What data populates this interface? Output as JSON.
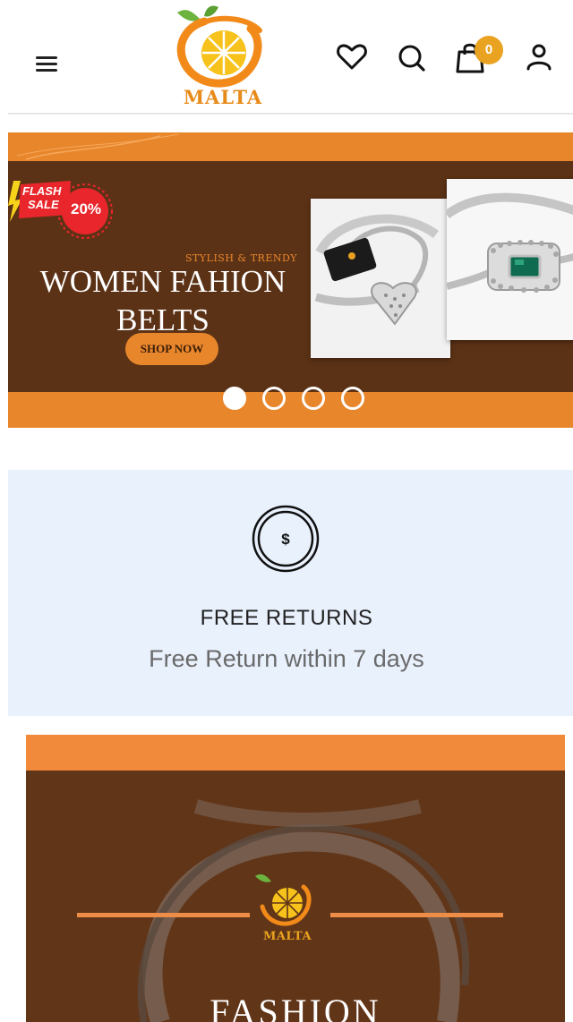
{
  "header": {
    "logo_text": "MALTA",
    "cart_count": "0",
    "icons": {
      "menu": "hamburger-menu-icon",
      "wishlist": "heart-icon",
      "search": "search-icon",
      "cart": "shopping-bag-icon",
      "account": "user-icon"
    }
  },
  "hero": {
    "flash_sale_line1": "FLASH",
    "flash_sale_line2": "SALE",
    "discount": "20%",
    "tagline": "STYLISH & TRENDY",
    "title_line1": "WOMEN FAHION",
    "title_line2": "BELTS",
    "button_label": "SHOP NOW",
    "slides": 4,
    "active_slide": 1
  },
  "feature": {
    "icon": "dollar-coin-icon",
    "title": "FREE RETURNS",
    "subtitle": "Free Return within 7 days"
  },
  "banner2": {
    "logo_text": "MALTA",
    "title": "FASHION"
  },
  "colors": {
    "brand_orange": "#e8862c",
    "banner_brown": "#5c3216",
    "badge": "#e9a320",
    "feature_bg": "#e9f1fd"
  }
}
